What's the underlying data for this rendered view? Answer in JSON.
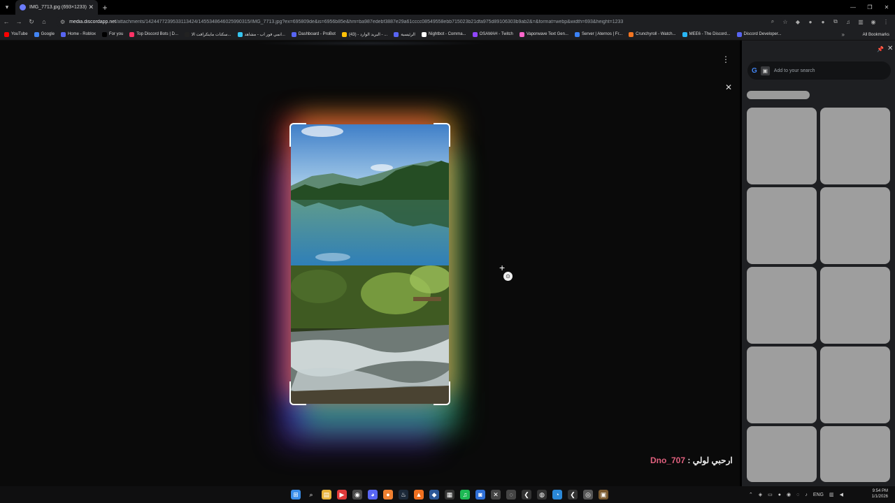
{
  "tab": {
    "title": "IMG_7713.jpg (693×1233)"
  },
  "toolbar": {
    "url_host": "media.discordapp.net",
    "url_path": "/attachments/1424477239533113424/1455348646025990315/IMG_7713.jpg?ex=695809de&is=6956b85e&hm=ba987edebf3887e29a61cccc08549558ebb715023b21dfa975d89106303b9ab2&=&format=webp&width=693&height=1233"
  },
  "bookmarks": [
    {
      "label": "YouTube",
      "color": "#ff0000"
    },
    {
      "label": "Google",
      "color": "#4285f4"
    },
    {
      "label": "Home - Roblox",
      "color": "#5865f2"
    },
    {
      "label": "For you",
      "color": "#000000"
    },
    {
      "label": "Top Discord Bots | D...",
      "color": "#ff3366"
    },
    {
      "label": "سكنات ماينكرافت الا...",
      "color": "#222222"
    },
    {
      "label": "انمي فور اب - مشاهد...",
      "color": "#36c5f0"
    },
    {
      "label": "Dashboard - ProBot",
      "color": "#5865f2"
    },
    {
      "label": "(43) - البريد الوارد - ...",
      "color": "#ffc107"
    },
    {
      "label": "الرئيسية",
      "color": "#5865f2"
    },
    {
      "label": "Nightbot - Comma...",
      "color": "#ffffff"
    },
    {
      "label": "OSAMAH - Twitch",
      "color": "#9146ff"
    },
    {
      "label": "Vaporwave Text Gen...",
      "color": "#ff66cc"
    },
    {
      "label": "Server | Aternos | Fr...",
      "color": "#3b82f6"
    },
    {
      "label": "Crunchyroll - Watch...",
      "color": "#f47521"
    },
    {
      "label": "MEE6 - The Discord...",
      "color": "#29b6f6"
    },
    {
      "label": "Discord Developer...",
      "color": "#5865f2"
    }
  ],
  "bookmarks_all": "All Bookmarks",
  "viewer": {
    "caption_user": "Dno_707",
    "caption_text": " : ارحبي لولي"
  },
  "side_panel": {
    "search_placeholder": "Add to your search"
  },
  "clock": {
    "time": "9:54 PM",
    "date": "1/1/2026"
  },
  "tray": {
    "lang": "ENG"
  }
}
